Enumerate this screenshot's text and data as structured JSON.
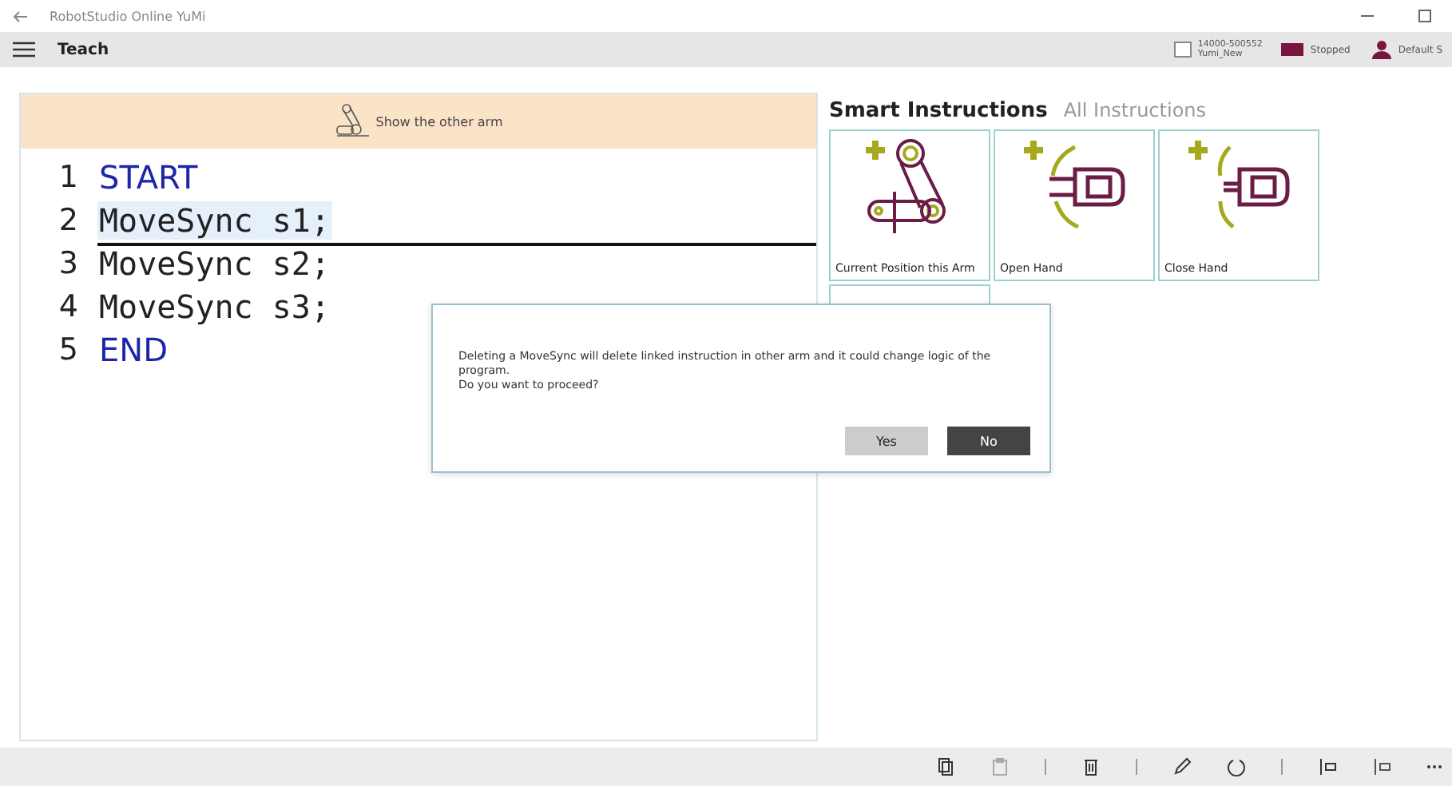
{
  "window": {
    "title": "RobotStudio Online YuMi"
  },
  "header": {
    "title": "Teach",
    "controller": {
      "id": "14000-500552",
      "name": "Yumi_New"
    },
    "status": "Stopped",
    "user": "Default S"
  },
  "banner": {
    "label": "Show the other arm"
  },
  "code_lines": [
    {
      "number": "1",
      "text": "START",
      "kind": "keyword",
      "selected": false
    },
    {
      "number": "2",
      "text": "MoveSync s1;",
      "kind": "statement",
      "selected": true
    },
    {
      "number": "3",
      "text": "MoveSync s2;",
      "kind": "statement",
      "selected": false
    },
    {
      "number": "4",
      "text": "MoveSync s3;",
      "kind": "statement",
      "selected": false
    },
    {
      "number": "5",
      "text": "END",
      "kind": "keyword",
      "selected": false
    }
  ],
  "tabs": [
    {
      "label": "Smart Instructions",
      "selected": true
    },
    {
      "label": "All Instructions",
      "selected": false
    }
  ],
  "instructions": [
    {
      "label": "Current Position this Arm",
      "kind": "position"
    },
    {
      "label": "Open Hand",
      "kind": "open"
    },
    {
      "label": "Close Hand",
      "kind": "close"
    },
    {
      "kind": "blank"
    }
  ],
  "dialog": {
    "message": "Deleting a MoveSync will delete linked instruction in other arm and it could change logic of the program.",
    "question": "Do you want to proceed?",
    "buttons": [
      "Yes",
      "No"
    ]
  }
}
